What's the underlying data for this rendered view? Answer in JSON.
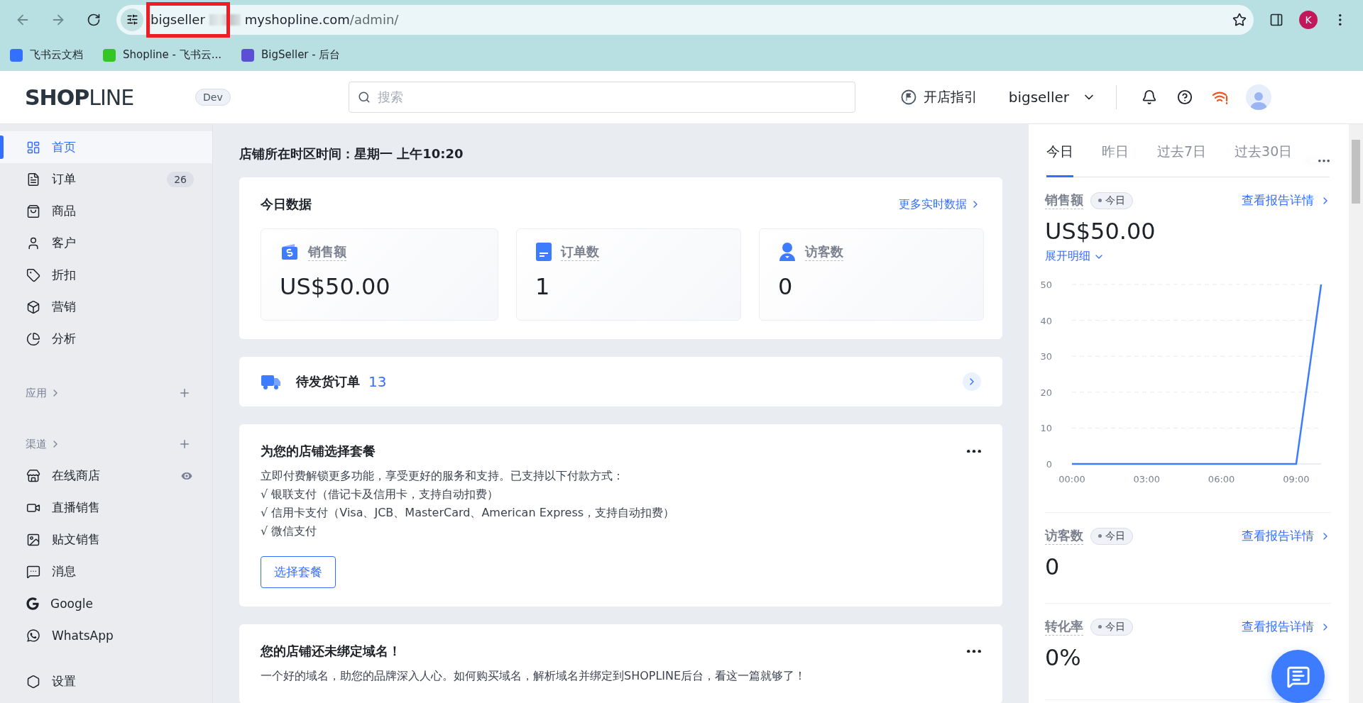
{
  "browser": {
    "url_start": "bigseller",
    "url_host": "myshopline.com",
    "url_path": "/admin/",
    "profile": "K",
    "bookmarks": [
      {
        "label": "飞书云文档",
        "color": "#3370ff"
      },
      {
        "label": "Shopline - 飞书云...",
        "color": "#34c724"
      },
      {
        "label": "BigSeller - 后台",
        "color": "#5b4fd6"
      }
    ]
  },
  "header": {
    "logo_bold": "SHOP",
    "logo_light": "LINE",
    "env_badge": "Dev",
    "search": {
      "placeholder": "搜索"
    },
    "guide": "开店指引",
    "store": "bigseller"
  },
  "sidebar": {
    "main": [
      {
        "label": "首页",
        "selected": true
      },
      {
        "label": "订单",
        "selected": false,
        "badge": "26"
      },
      {
        "label": "商品",
        "selected": false
      },
      {
        "label": "客户",
        "selected": false
      },
      {
        "label": "折扣",
        "selected": false
      },
      {
        "label": "营销",
        "selected": false
      },
      {
        "label": "分析",
        "selected": false
      }
    ],
    "sections": [
      {
        "title": "应用"
      },
      {
        "title": "渠道",
        "items": [
          {
            "label": "在线商店",
            "selected": false
          },
          {
            "label": "直播销售",
            "selected": false
          },
          {
            "label": "贴文销售",
            "selected": false
          },
          {
            "label": "消息",
            "selected": false
          },
          {
            "label": "Google",
            "selected": false
          },
          {
            "label": "WhatsApp",
            "selected": false
          }
        ]
      }
    ],
    "settings": {
      "label": "设置",
      "selected": false
    }
  },
  "main": {
    "store_time": "店铺所在时区时间：星期一 上午10:20",
    "today": {
      "title": "今日数据",
      "more": "更多实时数据",
      "metrics": [
        {
          "label": "销售额",
          "value": "US$50.00"
        },
        {
          "label": "订单数",
          "value": "1"
        },
        {
          "label": "访客数",
          "value": "0"
        }
      ]
    },
    "pending": {
      "label": "待发货订单",
      "count": "13"
    },
    "plan_card": {
      "title": "为您的店铺选择套餐",
      "lines": [
        "立即付费解锁更多功能，享受更好的服务和支持。已支持以下付款方式：",
        "√ 银联支付（借记卡及信用卡，支持自动扣费）",
        "√ 信用卡支付（Visa、JCB、MasterCard、American Express，支持自动扣费）",
        "√ 微信支付"
      ],
      "button": "选择套餐"
    },
    "domain_card": {
      "title": "您的店铺还未绑定域名！",
      "text": "一个好的域名，助您的品牌深入人心。如何购买域名，解析域名并绑定到SHOPLINE后台，看这一篇就够了！"
    }
  },
  "right_panel": {
    "tabs": [
      {
        "label": "今日",
        "selected": true
      },
      {
        "label": "昨日",
        "selected": false
      },
      {
        "label": "过去7日",
        "selected": false
      },
      {
        "label": "过去30日",
        "selected": false
      }
    ],
    "metrics": [
      {
        "kind": "chart",
        "label": "销售额",
        "period": "今日",
        "link": "查看报告详情",
        "value": "US$50.00",
        "expand": "展开明细",
        "chart_data": {
          "type": "line",
          "grid": true,
          "xlim": [
            0,
            10
          ],
          "x": [
            0,
            1,
            2,
            3,
            4,
            5,
            6,
            7,
            8,
            9,
            10
          ],
          "xticks": [
            {
              "value": 0,
              "label": "00:00"
            },
            {
              "value": 3,
              "label": "03:00"
            },
            {
              "value": 6,
              "label": "06:00"
            },
            {
              "value": 9,
              "label": "09:00"
            }
          ],
          "yticks": [
            0,
            10,
            20,
            30,
            40,
            50
          ],
          "ylim": [
            0,
            50
          ],
          "series": [
            {
              "color": "#3d7cff",
              "values": [
                0,
                0,
                0,
                0,
                0,
                0,
                0,
                0,
                0,
                0,
                50
              ]
            }
          ]
        }
      },
      {
        "kind": "plain",
        "label": "访客数",
        "period": "今日",
        "link": "查看报告详情",
        "value": "0"
      },
      {
        "kind": "plain",
        "label": "转化率",
        "period": "今日",
        "link": "查看报告详情",
        "value": "0%"
      }
    ]
  }
}
